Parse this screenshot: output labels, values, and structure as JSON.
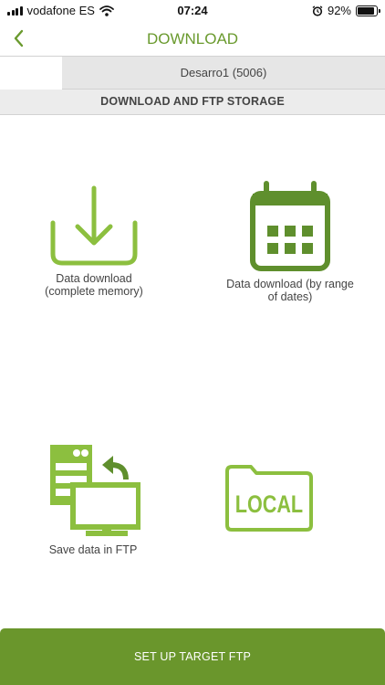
{
  "status_bar": {
    "carrier": "vodafone ES",
    "time": "07:24",
    "battery_percent": "92%",
    "battery_level": 0.92,
    "icons": [
      "signal-icon",
      "wifi-icon",
      "alarm-icon",
      "battery-icon"
    ]
  },
  "header": {
    "back_icon": "chevron-left-icon",
    "title": "DOWNLOAD"
  },
  "device": {
    "name": "Desarro1 (5006)"
  },
  "section": {
    "title": "DOWNLOAD AND FTP STORAGE"
  },
  "options": {
    "download_all": {
      "icon": "download-tray-icon",
      "label": "Data download\n(complete memory)"
    },
    "download_range": {
      "icon": "calendar-icon",
      "label": "Data download (by range\nof dates)"
    },
    "ftp": {
      "icon": "server-to-monitor-icon",
      "label": "Save data in FTP"
    },
    "local": {
      "icon": "local-folder-icon",
      "label": "LOCAL"
    }
  },
  "footer": {
    "button_label": "SET UP TARGET FTP"
  },
  "colors": {
    "accent": "#6a962c",
    "icon_light": "#8cbf3f",
    "icon_dark": "#5f8f2d",
    "title": "#6a9a2e"
  }
}
